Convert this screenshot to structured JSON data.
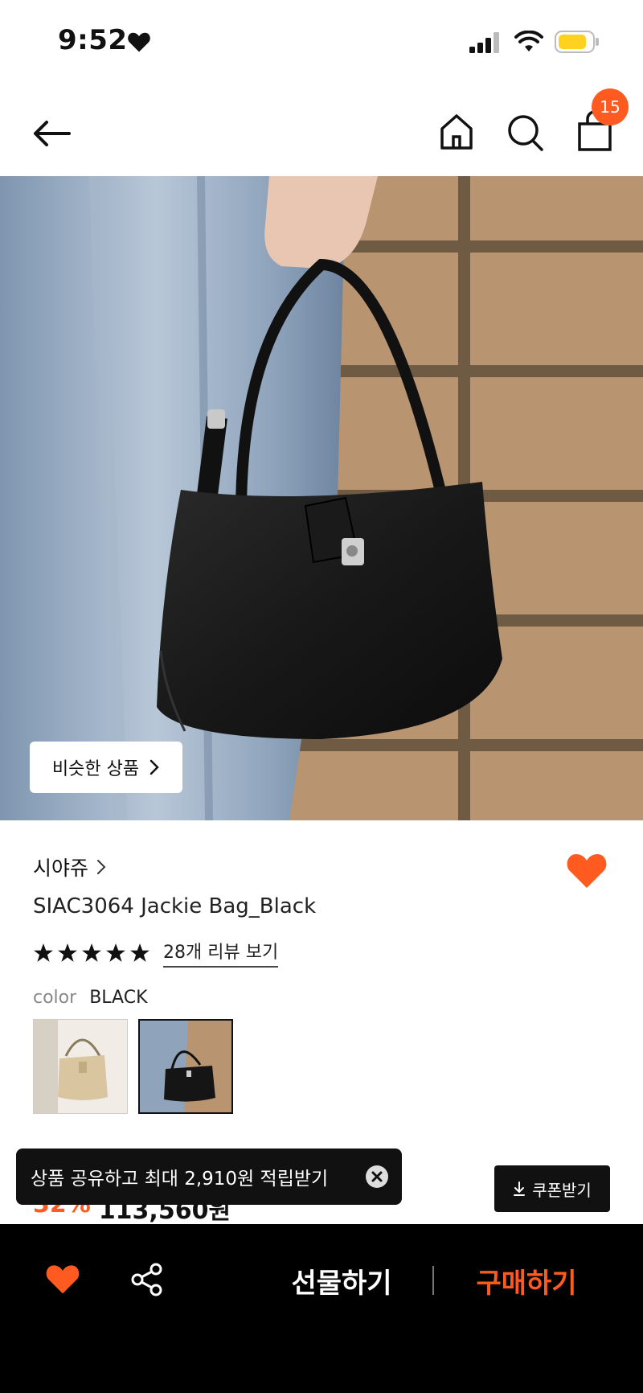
{
  "status_bar": {
    "time": "9:52"
  },
  "nav": {
    "cart_count": "15"
  },
  "hero": {
    "similar_label": "비슷한 상품"
  },
  "product": {
    "brand": "시야쥬",
    "title": "SIAC3064 Jackie Bag_Black",
    "rating_stars": 5,
    "review_link": "28개 리뷰 보기",
    "color_label": "color",
    "color_value": "BLACK",
    "price_discount": "32%",
    "price_value": "113,560원"
  },
  "toast": {
    "share_text": "상품 공유하고 최대 2,910원 적립받기"
  },
  "coupon": {
    "label": "쿠폰받기"
  },
  "bottom_bar": {
    "gift_label": "선물하기",
    "buy_label": "구매하기"
  },
  "colors": {
    "accent": "#ff5a1f",
    "dark": "#111111"
  },
  "icons": [
    "heart-icon",
    "signal-icon",
    "wifi-icon",
    "battery-icon",
    "back-arrow-icon",
    "home-icon",
    "search-icon",
    "shopping-bag-icon",
    "chevron-right-icon",
    "star-icon",
    "close-icon",
    "download-icon",
    "share-icon"
  ]
}
